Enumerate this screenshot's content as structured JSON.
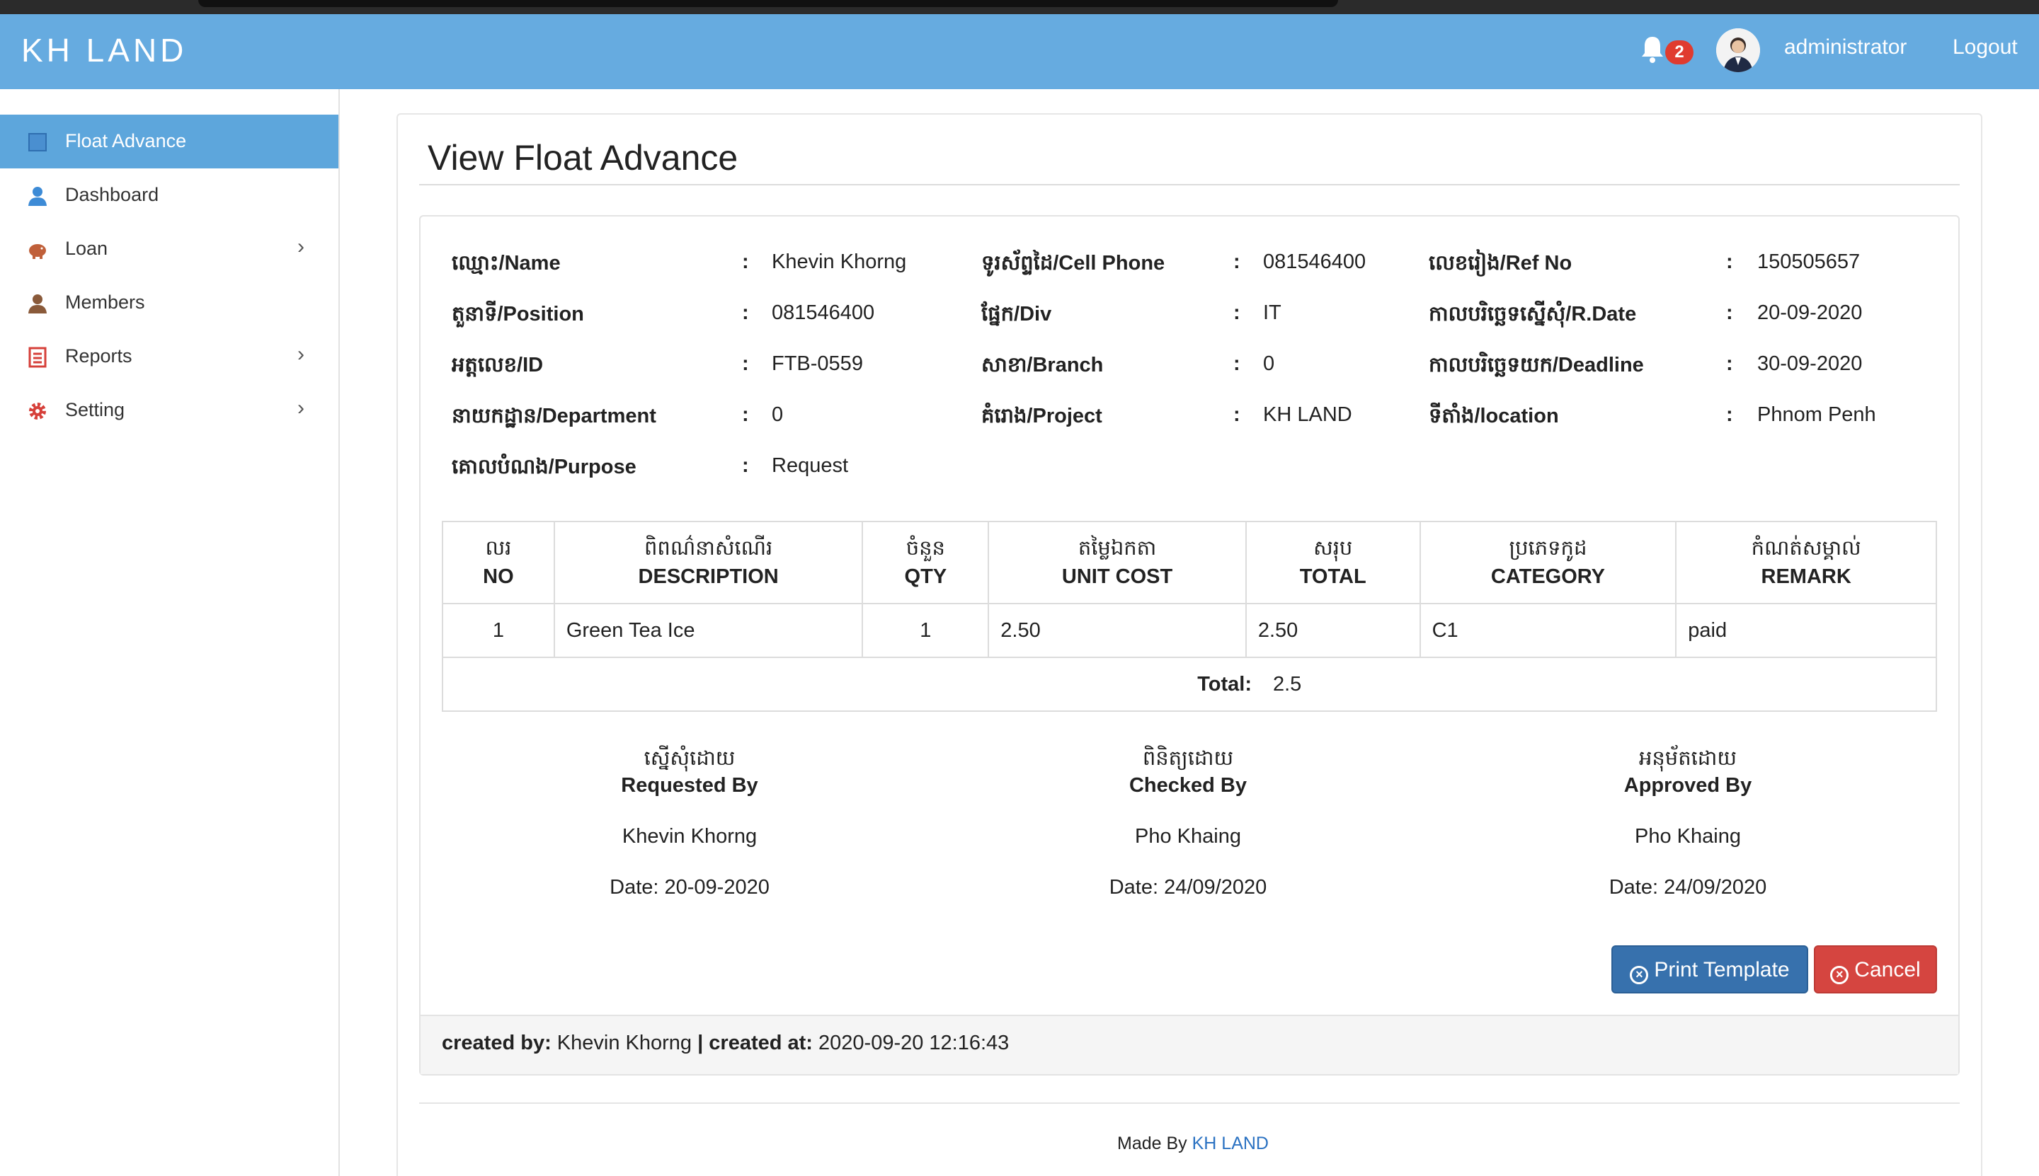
{
  "brand": "KH LAND",
  "header": {
    "notifications": "2",
    "user": "administrator",
    "logout": "Logout"
  },
  "sidebar": {
    "items": [
      {
        "label": "Float Advance",
        "icon": "grid-icon",
        "active": true
      },
      {
        "label": "Dashboard",
        "icon": "user-icon"
      },
      {
        "label": "Loan",
        "icon": "piggy-bank-icon",
        "chevron": true
      },
      {
        "label": "Members",
        "icon": "user-icon"
      },
      {
        "label": "Reports",
        "icon": "list-icon",
        "chevron": true
      },
      {
        "label": "Setting",
        "icon": "gear-icon",
        "chevron": true
      }
    ]
  },
  "page": {
    "title": "View Float Advance"
  },
  "info": {
    "name": {
      "label": "ឈ្មោះ/Name",
      "value": "Khevin Khorng"
    },
    "position": {
      "label": "តួនាទី/Position",
      "value": "081546400"
    },
    "id": {
      "label": "អត្តលេខ/ID",
      "value": "FTB-0559"
    },
    "department": {
      "label": "នាយកដ្ឋាន/Department",
      "value": "0"
    },
    "purpose": {
      "label": "គោលបំណង/Purpose",
      "value": "Request"
    },
    "cell_phone": {
      "label": "ទូរស័ព្ទដៃ/Cell Phone",
      "value": "081546400"
    },
    "div": {
      "label": "ផ្នែក/Div",
      "value": "IT"
    },
    "branch": {
      "label": "សាខា/Branch",
      "value": "0"
    },
    "project": {
      "label": "គំរោង/Project",
      "value": "KH LAND"
    },
    "ref_no": {
      "label": "លេខរៀង/Ref No",
      "value": "150505657"
    },
    "r_date": {
      "label": "កាលបរិច្ឆេទស្នើសុំ/R.Date",
      "value": "20-09-2020"
    },
    "deadline": {
      "label": "កាលបរិច្ឆេទយក/Deadline",
      "value": "30-09-2020"
    },
    "location": {
      "label": "ទីតាំង/location",
      "value": "Phnom Penh"
    }
  },
  "table": {
    "headers": [
      {
        "km": "លរ",
        "en": "NO"
      },
      {
        "km": "ពិពណ៌នាសំណើរ",
        "en": "DESCRIPTION"
      },
      {
        "km": "ចំនួន",
        "en": "QTY"
      },
      {
        "km": "តម្លៃឯកតា",
        "en": "UNIT COST"
      },
      {
        "km": "សរុប",
        "en": "TOTAL"
      },
      {
        "km": "ប្រភេទកូដ",
        "en": "CATEGORY"
      },
      {
        "km": "កំណត់សម្គាល់",
        "en": "REMARK"
      }
    ],
    "rows": [
      {
        "no": "1",
        "description": "Green Tea Ice",
        "qty": "1",
        "unit_cost": "2.50",
        "total": "2.50",
        "category": "C1",
        "remark": "paid"
      }
    ],
    "total_label": "Total:",
    "total_value": "2.5"
  },
  "signatures": {
    "requested": {
      "km": "ស្នើសុំដោយ",
      "en": "Requested By",
      "name": "Khevin Khorng",
      "date": "Date: 20-09-2020"
    },
    "checked": {
      "km": "ពិនិត្យដោយ",
      "en": "Checked By",
      "name": "Pho Khaing",
      "date": "Date: 24/09/2020"
    },
    "approved": {
      "km": "អនុម័តដោយ",
      "en": "Approved By",
      "name": "Pho Khaing",
      "date": "Date: 24/09/2020"
    }
  },
  "buttons": {
    "print": "Print Template",
    "cancel": "Cancel"
  },
  "footer": {
    "created_by_label": "created by:",
    "created_by": "Khevin Khorng",
    "sep": "|",
    "created_at_label": "created at:",
    "created_at": "2020-09-20 12:16:43",
    "made_by": "Made By",
    "made_by_link": "KH LAND"
  },
  "colors": {
    "navbar": "#66abe0",
    "sidebar_active": "#5da6dc",
    "print_button": "#3771ad",
    "cancel_button": "#d54540",
    "badge": "#e03b2f"
  }
}
